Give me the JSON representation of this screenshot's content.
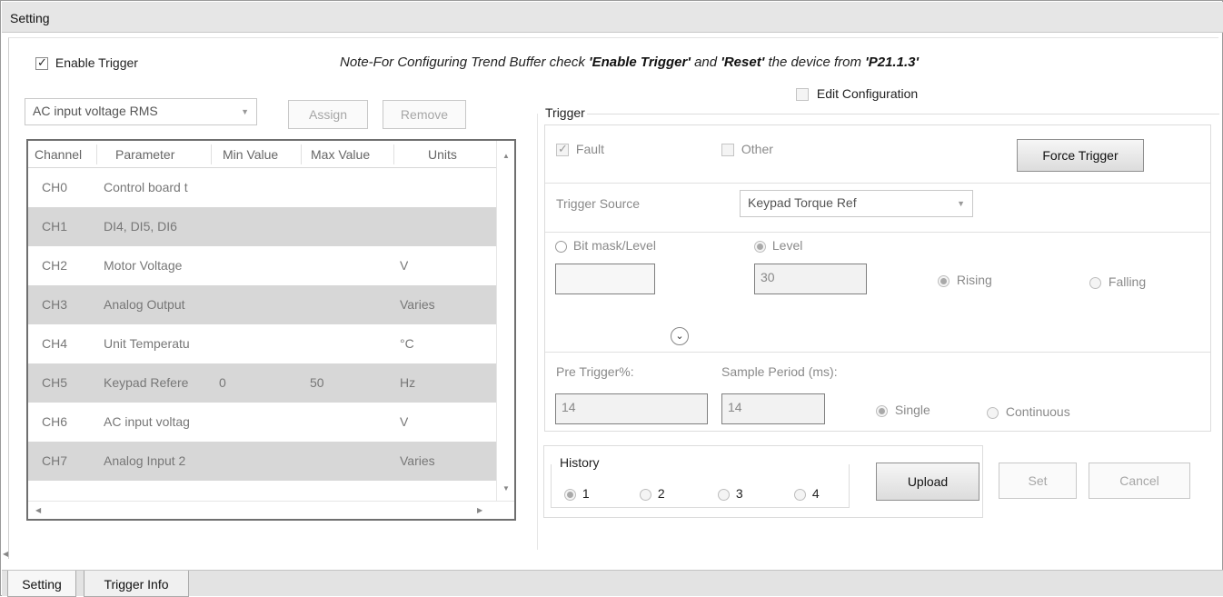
{
  "window": {
    "title": "Setting"
  },
  "enable_trigger": {
    "label": "Enable Trigger",
    "checked": true
  },
  "note": {
    "prefix": "Note-For Configuring Trend Buffer check ",
    "b1": "'Enable Trigger'",
    "mid": " and ",
    "b2": "'Reset'",
    "mid2": " the device from ",
    "b3": "'P21.1.3'"
  },
  "edit_configuration": {
    "label": "Edit Configuration",
    "checked": false
  },
  "parameter_select": {
    "value": "AC input voltage RMS"
  },
  "buttons": {
    "assign": "Assign",
    "remove": "Remove",
    "force_trigger": "Force Trigger",
    "upload": "Upload",
    "set": "Set",
    "cancel": "Cancel"
  },
  "grid": {
    "headers": [
      "Channel",
      "Parameter",
      "Min Value",
      "Max Value",
      "Units"
    ],
    "rows": [
      {
        "channel": "CH0",
        "parameter": "Control board t",
        "min": "",
        "max": "",
        "units": ""
      },
      {
        "channel": "CH1",
        "parameter": "DI4, DI5, DI6",
        "min": "",
        "max": "",
        "units": ""
      },
      {
        "channel": "CH2",
        "parameter": "Motor Voltage",
        "min": "",
        "max": "",
        "units": "V"
      },
      {
        "channel": "CH3",
        "parameter": "Analog Output",
        "min": "",
        "max": "",
        "units": "Varies"
      },
      {
        "channel": "CH4",
        "parameter": "Unit Temperatu",
        "min": "",
        "max": "",
        "units": "°C"
      },
      {
        "channel": "CH5",
        "parameter": "Keypad Refere",
        "min": "0",
        "max": "50",
        "units": "Hz"
      },
      {
        "channel": "CH6",
        "parameter": "AC input voltag",
        "min": "",
        "max": "",
        "units": "V"
      },
      {
        "channel": "CH7",
        "parameter": "Analog Input 2",
        "min": "",
        "max": "",
        "units": "Varies"
      }
    ]
  },
  "trigger": {
    "group_title": "Trigger",
    "fault": {
      "label": "Fault",
      "checked": true
    },
    "other": {
      "label": "Other",
      "checked": false
    },
    "source_label": "Trigger Source",
    "source_value": "Keypad Torque Ref",
    "bitmask_label": "Bit mask/Level",
    "level_label": "Level",
    "bitmask_value": "",
    "level_value": "30",
    "rising_label": "Rising",
    "falling_label": "Falling",
    "pre_trigger_label": "Pre Trigger%:",
    "sample_period_label": "Sample Period (ms):",
    "pre_trigger_value": "14",
    "sample_period_value": "14",
    "single_label": "Single",
    "continuous_label": "Continuous"
  },
  "history": {
    "title": "History",
    "options": [
      "1",
      "2",
      "3",
      "4"
    ],
    "selected": "1"
  },
  "tabs": [
    "Setting",
    "Trigger Info"
  ]
}
